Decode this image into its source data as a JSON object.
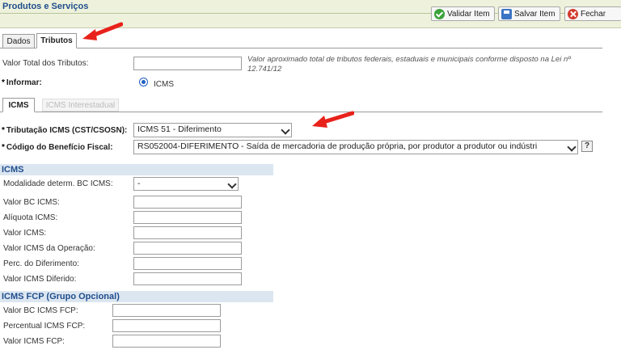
{
  "header": {
    "title": "Produtos e Serviços",
    "buttons": {
      "validate": "Validar Item",
      "save": "Salvar Item",
      "close": "Fechar"
    }
  },
  "tabs": {
    "dados": "Dados",
    "tributos": "Tributos"
  },
  "total_tributos": {
    "label": "Valor Total dos Tributos:",
    "note": "Valor aproximado total de tributos federais, estaduais e municipais conforme disposto na Lei nº 12.741/12"
  },
  "informar": {
    "label": "Informar:",
    "option": "ICMS"
  },
  "subtabs": {
    "icms": "ICMS",
    "icms_interestadual": "ICMS Interestadual"
  },
  "tributacao": {
    "label": "Tributação ICMS (CST/CSOSN):",
    "value": "ICMS 51 - Diferimento"
  },
  "beneficio": {
    "label": "Código do Benefício Fiscal:",
    "value": "RS052004-DIFERIMENTO - Saída de mercadoria de produção própria, por produtor a produtor ou indústri",
    "help": "?"
  },
  "icms_section": {
    "title": "ICMS",
    "modalidade": {
      "label": "Modalidade determ. BC ICMS:",
      "value": "-"
    },
    "fields": [
      "Valor BC ICMS:",
      "Alíquota ICMS:",
      "Valor ICMS:",
      "Valor ICMS da Operação:",
      "Perc. do Diferimento:",
      "Valor ICMS Diferido:"
    ]
  },
  "fcp_section": {
    "title": "ICMS FCP (Grupo Opcional)",
    "fields": [
      "Valor BC ICMS FCP:",
      "Percentual ICMS FCP:",
      "Valor ICMS FCP:"
    ]
  },
  "colors": {
    "header_bg": "#eef2dc",
    "section_bg": "#dce6f1",
    "title_blue": "#1f4e8c",
    "arrow_red": "#e8221b"
  }
}
